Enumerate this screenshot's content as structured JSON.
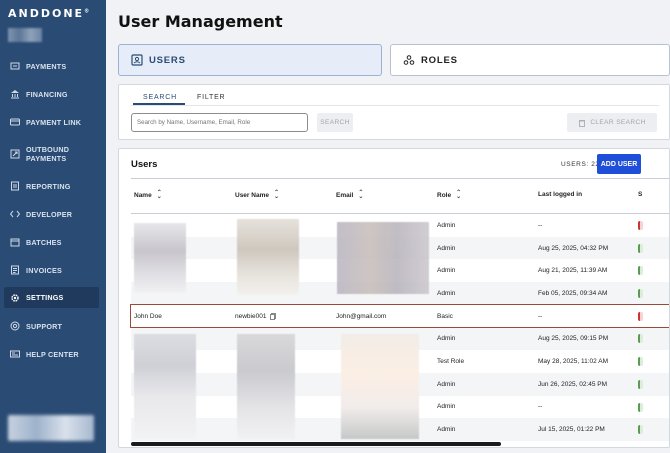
{
  "brand": {
    "logo_text": "ANDDONE",
    "trademark": "®"
  },
  "sidebar": {
    "items": [
      {
        "label": "PAYMENTS",
        "icon": "payments-icon"
      },
      {
        "label": "FINANCING",
        "icon": "bank-icon"
      },
      {
        "label": "PAYMENT LINK",
        "icon": "card-icon"
      },
      {
        "label": "OUTBOUND\nPAYMENTS",
        "line1": "OUTBOUND",
        "line2": "PAYMENTS",
        "icon": "outbound-icon"
      },
      {
        "label": "REPORTING",
        "icon": "report-icon"
      },
      {
        "label": "DEVELOPER",
        "icon": "code-icon"
      },
      {
        "label": "BATCHES",
        "icon": "batches-icon"
      },
      {
        "label": "INVOICES",
        "icon": "invoice-icon"
      },
      {
        "label": "SETTINGS",
        "icon": "gear-icon",
        "active": true
      },
      {
        "label": "SUPPORT",
        "icon": "support-icon"
      },
      {
        "label": "HELP CENTER",
        "icon": "help-icon"
      }
    ]
  },
  "page": {
    "title": "User Management"
  },
  "tabs": {
    "users": "USERS",
    "roles": "ROLES"
  },
  "search": {
    "tab_search": "SEARCH",
    "tab_filter": "FILTER",
    "placeholder": "Search by Name, Username, Email, Role",
    "search_button": "SEARCH",
    "clear_button": "CLEAR SEARCH"
  },
  "users_panel": {
    "title": "Users",
    "count_label": "USERS: 22",
    "add_button": "ADD USER",
    "columns": {
      "name": "Name",
      "username": "User Name",
      "email": "Email",
      "role": "Role",
      "last_logged_in": "Last logged in",
      "status_partial": "S"
    },
    "rows": [
      {
        "name": "",
        "username": "",
        "email": "",
        "role": "Admin",
        "last": "--",
        "status": "red"
      },
      {
        "name": "",
        "username": "",
        "email": "",
        "role": "Admin",
        "last": "Aug 25, 2025, 04:32 PM",
        "status": "green"
      },
      {
        "name": "",
        "username": "",
        "email": "",
        "role": "Admin",
        "last": "Aug 21, 2025, 11:39 AM",
        "status": "green"
      },
      {
        "name": "",
        "username": "",
        "email": "",
        "role": "Admin",
        "last": "Feb 05, 2025, 09:34 AM",
        "status": "green"
      },
      {
        "name": "John Doe",
        "username": "newbie001",
        "email": "John@gmail.com",
        "role": "Basic",
        "last": "--",
        "status": "red",
        "highlight": true
      },
      {
        "name": "",
        "username": "",
        "email": "",
        "role": "Admin",
        "last": "Aug 25, 2025, 09:15 PM",
        "status": "green"
      },
      {
        "name": "",
        "username": "",
        "email": "",
        "role": "Test Role",
        "last": "May 28, 2025, 11:02 AM",
        "status": "green"
      },
      {
        "name": "",
        "username": "",
        "email": "",
        "role": "Admin",
        "last": "Jun 26, 2025, 02:45 PM",
        "status": "green"
      },
      {
        "name": "",
        "username": "",
        "email": "",
        "role": "Admin",
        "last": "--",
        "status": "green"
      },
      {
        "name": "",
        "username": "",
        "email": "",
        "role": "Admin",
        "last": "Jul 15, 2025, 01:22 PM",
        "status": "green"
      }
    ]
  },
  "colors": {
    "sidebar": "#2a4b73",
    "accent": "#1f4fd8",
    "highlight_border": "#9a4a3b"
  }
}
